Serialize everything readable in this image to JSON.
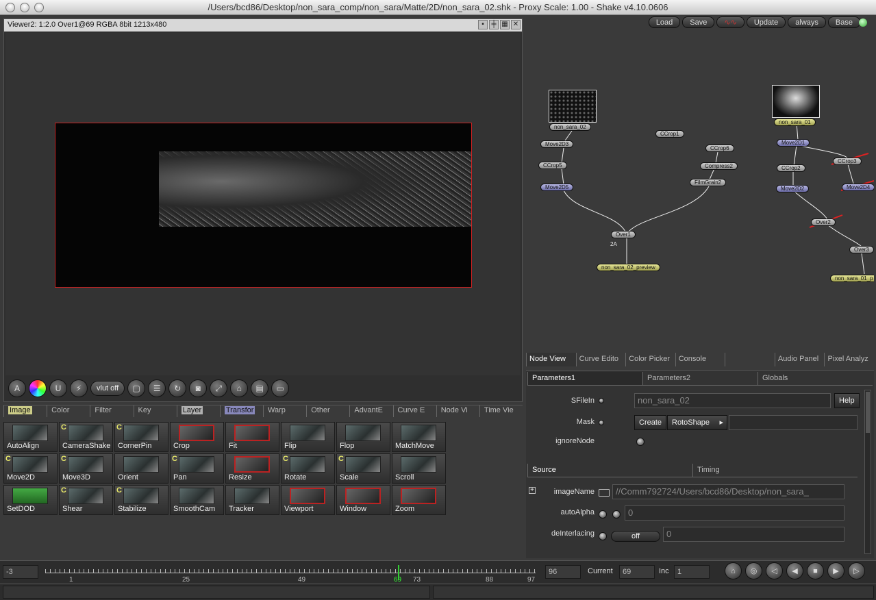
{
  "window": {
    "title": "/Users/bcd86/Desktop/non_sara_comp/non_sara/Matte/2D/non_sara_02.shk - Proxy Scale: 1.00 - Shake v4.10.0606"
  },
  "viewer": {
    "header": "Viewer2: 1:2.0 Over1@69 RGBA 8bit 1213x480",
    "toolbar": {
      "vlut_label": "vlut off"
    }
  },
  "tool_tabs": [
    {
      "label": "Image"
    },
    {
      "label": "Color"
    },
    {
      "label": "Filter"
    },
    {
      "label": "Key"
    },
    {
      "label": "Layer"
    },
    {
      "label": "Transfor"
    },
    {
      "label": "Warp"
    },
    {
      "label": "Other"
    },
    {
      "label": "AdvantE"
    },
    {
      "label": "Curve E"
    },
    {
      "label": "Node Vi"
    },
    {
      "label": "Time Vie"
    }
  ],
  "tools": [
    {
      "label": "AutoAlign",
      "c": ""
    },
    {
      "label": "CameraShake",
      "c": "C"
    },
    {
      "label": "CornerPin",
      "c": "C"
    },
    {
      "label": "Crop",
      "c": ""
    },
    {
      "label": "Fit",
      "c": ""
    },
    {
      "label": "Flip",
      "c": ""
    },
    {
      "label": "Flop",
      "c": ""
    },
    {
      "label": "MatchMove",
      "c": ""
    },
    {
      "label": "Move2D",
      "c": "C"
    },
    {
      "label": "Move3D",
      "c": "C"
    },
    {
      "label": "Orient",
      "c": ""
    },
    {
      "label": "Pan",
      "c": "C"
    },
    {
      "label": "Resize",
      "c": ""
    },
    {
      "label": "Rotate",
      "c": "C"
    },
    {
      "label": "Scale",
      "c": "C"
    },
    {
      "label": "Scroll",
      "c": ""
    },
    {
      "label": "SetDOD",
      "c": ""
    },
    {
      "label": "Shear",
      "c": "C"
    },
    {
      "label": "Stabilize",
      "c": "C"
    },
    {
      "label": "SmoothCam",
      "c": ""
    },
    {
      "label": "Tracker",
      "c": ""
    },
    {
      "label": "Viewport",
      "c": ""
    },
    {
      "label": "Window",
      "c": ""
    },
    {
      "label": "Zoom",
      "c": ""
    }
  ],
  "right_toolbar": {
    "load": "Load",
    "save": "Save",
    "update": "Update",
    "always": "always",
    "base": "Base"
  },
  "nodes": {
    "non_sara_02": "non_sara_02",
    "move2d3": "Move2D3",
    "ccrop5": "CCrop5",
    "move2d5": "Move2D5",
    "ccrop1": "CCrop1",
    "ccrop6": "CCrop6",
    "compress2": "Compress2",
    "filmgrain2": "FilmGrain2",
    "over1": "Over1",
    "over1_tag": "2A",
    "preview": "non_sara_02_preview",
    "non_sara_01": "non_sara_01",
    "move2d1": "Move2D1",
    "ccrop2": "CCrop2",
    "ccrop3": "CCrop3",
    "move2d2": "Move2D2",
    "move2d4": "Move2D4",
    "over2": "Over2",
    "over3": "Over3",
    "non_sara_01_p": "non_sara_01_p"
  },
  "panel_tabs": [
    {
      "label": "Node View"
    },
    {
      "label": "Curve Edito"
    },
    {
      "label": "Color Picker"
    },
    {
      "label": "Console"
    },
    {
      "label": ""
    },
    {
      "label": "Audio Panel"
    },
    {
      "label": "Pixel Analyz"
    }
  ],
  "params": {
    "tabs": [
      {
        "label": "Parameters1"
      },
      {
        "label": "Parameters2"
      },
      {
        "label": "Globals"
      }
    ],
    "sfilein_label": "SFileIn",
    "sfilein_value": "non_sara_02",
    "help": "Help",
    "mask_label": "Mask",
    "create": "Create",
    "mask_value": "RotoShape",
    "ignore_label": "ignoreNode",
    "sub_tabs": [
      {
        "label": "Source"
      },
      {
        "label": "Timing"
      }
    ],
    "imagename_label": "imageName",
    "imagename_value": "//Comm792724/Users/bcd86/Desktop/non_sara_",
    "autoalpha_label": "autoAlpha",
    "autoalpha_value": "0",
    "deinterlacing_label": "deInterlacing",
    "deinterlacing_mode": "off",
    "deinterlacing_value": "0"
  },
  "timeline": {
    "start": "-3",
    "ticks": [
      "1",
      "25",
      "49",
      "69",
      "73",
      "88",
      "97"
    ],
    "end": "96",
    "current_label": "Current",
    "current_value": "69",
    "inc_label": "Inc",
    "inc_value": "1",
    "current_frame": 69
  }
}
